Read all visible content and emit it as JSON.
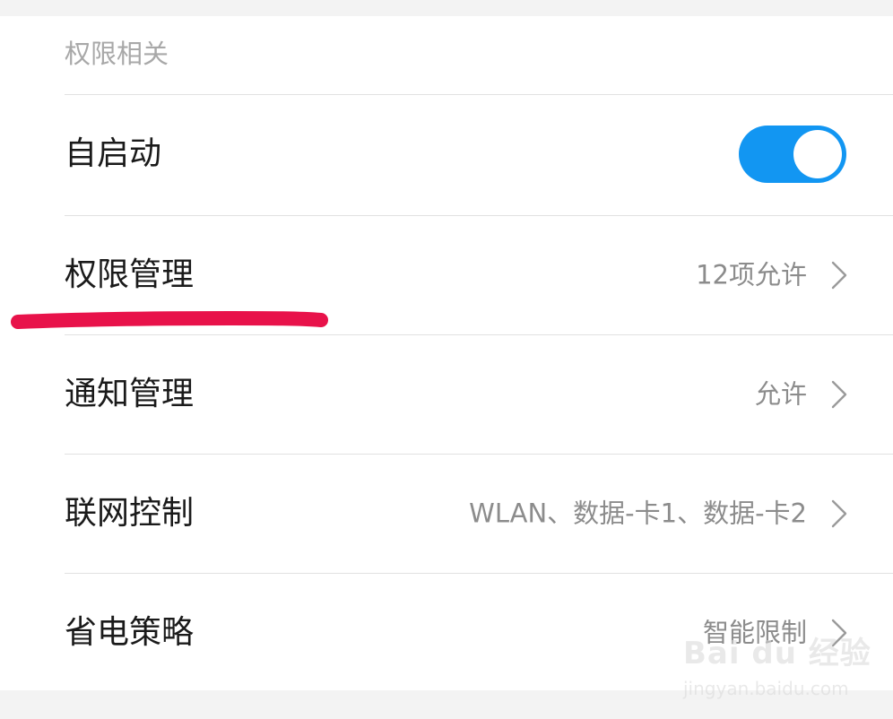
{
  "section": {
    "title": "权限相关"
  },
  "rows": [
    {
      "label": "自启动",
      "value": "",
      "control": "toggle",
      "toggle_on": true
    },
    {
      "label": "权限管理",
      "value": "12项允许",
      "control": "chevron"
    },
    {
      "label": "通知管理",
      "value": "允许",
      "control": "chevron"
    },
    {
      "label": "联网控制",
      "value": "WLAN、数据-卡1、数据-卡2",
      "control": "chevron"
    },
    {
      "label": "省电策略",
      "value": "智能限制",
      "control": "chevron"
    }
  ],
  "colors": {
    "toggle_on": "#1296f2",
    "annotation": "#e8124a",
    "label": "#1a1a1a",
    "value": "#8c8c8c",
    "separator": "#e1e1e1"
  },
  "icons": {
    "chevron": "chevron-right-icon"
  },
  "watermark": {
    "logo": "Bai du 经验",
    "url": "jingyan.baidu.com"
  }
}
